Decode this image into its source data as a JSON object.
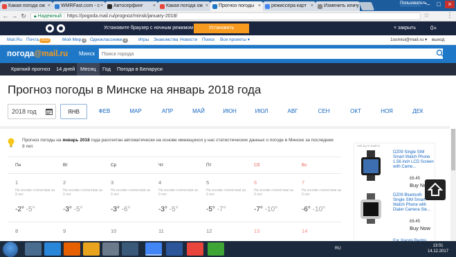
{
  "browser": {
    "tabs": [
      {
        "label": "Какая погода ож",
        "color": "#e8453c"
      },
      {
        "label": "WMRFast.com - с",
        "color": "#2e7bd3"
      },
      {
        "label": "Автосерфинг",
        "color": "#2b2b2b"
      },
      {
        "label": "Какая погода ож",
        "color": "#e8453c"
      },
      {
        "label": "Прогноз погоды",
        "color": "#1f78c7"
      },
      {
        "label": "режиссера карт",
        "color": "#4285f4"
      },
      {
        "label": "Изменить или у",
        "color": "#888888"
      }
    ],
    "user_badge": "Пользователь",
    "secure_label": "Надежный",
    "url": "https://pogoda.mail.ru/prognoz/minsk/january-2018/"
  },
  "promo": {
    "text": "Установите браузер с ночным режимом",
    "button": "Установить",
    "close": "× закрыть",
    "counter": "0+"
  },
  "portal_nav": {
    "items": [
      {
        "label": "Mail.Ru",
        "badge": ""
      },
      {
        "label": "Почта",
        "badge": "2632"
      },
      {
        "label": "Мой Мир",
        "badge": "2"
      },
      {
        "label": "Одноклассники",
        "badge": "3"
      },
      {
        "label": "Игры",
        "badge": ""
      },
      {
        "label": "Знакомства",
        "badge": ""
      },
      {
        "label": "Новости",
        "badge": ""
      },
      {
        "label": "Поиск",
        "badge": ""
      },
      {
        "label": "Все проекты ▾",
        "badge": ""
      }
    ],
    "user": "1osmisi@mail.ru ▾",
    "logout": "выход"
  },
  "weather_header": {
    "logo_main": "погода",
    "logo_mail": "@mail.ru",
    "city": "Минск",
    "search_placeholder": "Поиск города"
  },
  "subnav": [
    "Краткий прогноз",
    "14 дней",
    "Месяц",
    "Год",
    "Погода в Беларуси"
  ],
  "page": {
    "title": "Прогноз погоды в Минске на январь 2018 года",
    "year": "2018 год",
    "months": [
      "янв",
      "фев",
      "мар",
      "апр",
      "май",
      "июн",
      "июл",
      "авг",
      "сен",
      "окт",
      "ноя",
      "дек"
    ],
    "info_prefix": "Прогноз погоды на ",
    "info_bold": "январь 2018",
    "info_suffix": " года рассчитан автоматически на основе имеющихся у нас статистических данных о погоде в Минске за последние 9 лет."
  },
  "calendar": {
    "weekdays": [
      "Пн",
      "Вт",
      "Ср",
      "Чт",
      "Пт",
      "Сб",
      "Вс"
    ],
    "note": "На основе статистики за 9 лет",
    "week1": [
      {
        "day": "1",
        "day_temp": "-2°",
        "night_temp": "-5°"
      },
      {
        "day": "2",
        "day_temp": "-3°",
        "night_temp": "-5°"
      },
      {
        "day": "3",
        "day_temp": "-3°",
        "night_temp": "-6°"
      },
      {
        "day": "4",
        "day_temp": "-3°",
        "night_temp": "-5°"
      },
      {
        "day": "5",
        "day_temp": "-5°",
        "night_temp": "-7°"
      },
      {
        "day": "6",
        "day_temp": "-7°",
        "night_temp": "-10°"
      },
      {
        "day": "7",
        "day_temp": "-6°",
        "night_temp": "-10°"
      }
    ],
    "week2": [
      "8",
      "9",
      "10",
      "11",
      "12",
      "13",
      "14"
    ]
  },
  "ad": {
    "header": "Ads by tc.mail.ru",
    "items": [
      {
        "title": "DZ09 Single SIM Smart Watch Phone 1.56 inch LCD Screen with Came...",
        "price": "£6.45",
        "buy": "Buy Now"
      },
      {
        "title": "DZ09 Bluetooth Single SIM Smart Watch Phone with Dialer Camera Sle...",
        "price": "£6.45",
        "buy": "Buy Now"
      },
      {
        "title": "For Xiaomi Redmi",
        "price": "",
        "buy": ""
      }
    ]
  },
  "taskbar": {
    "lang": "RU",
    "time": "13:01",
    "date": "14.12.2017"
  },
  "colors": {
    "brand_blue": "#1f78c7",
    "accent_orange": "#f79a1e",
    "weekend_red": "#e05a4e"
  }
}
